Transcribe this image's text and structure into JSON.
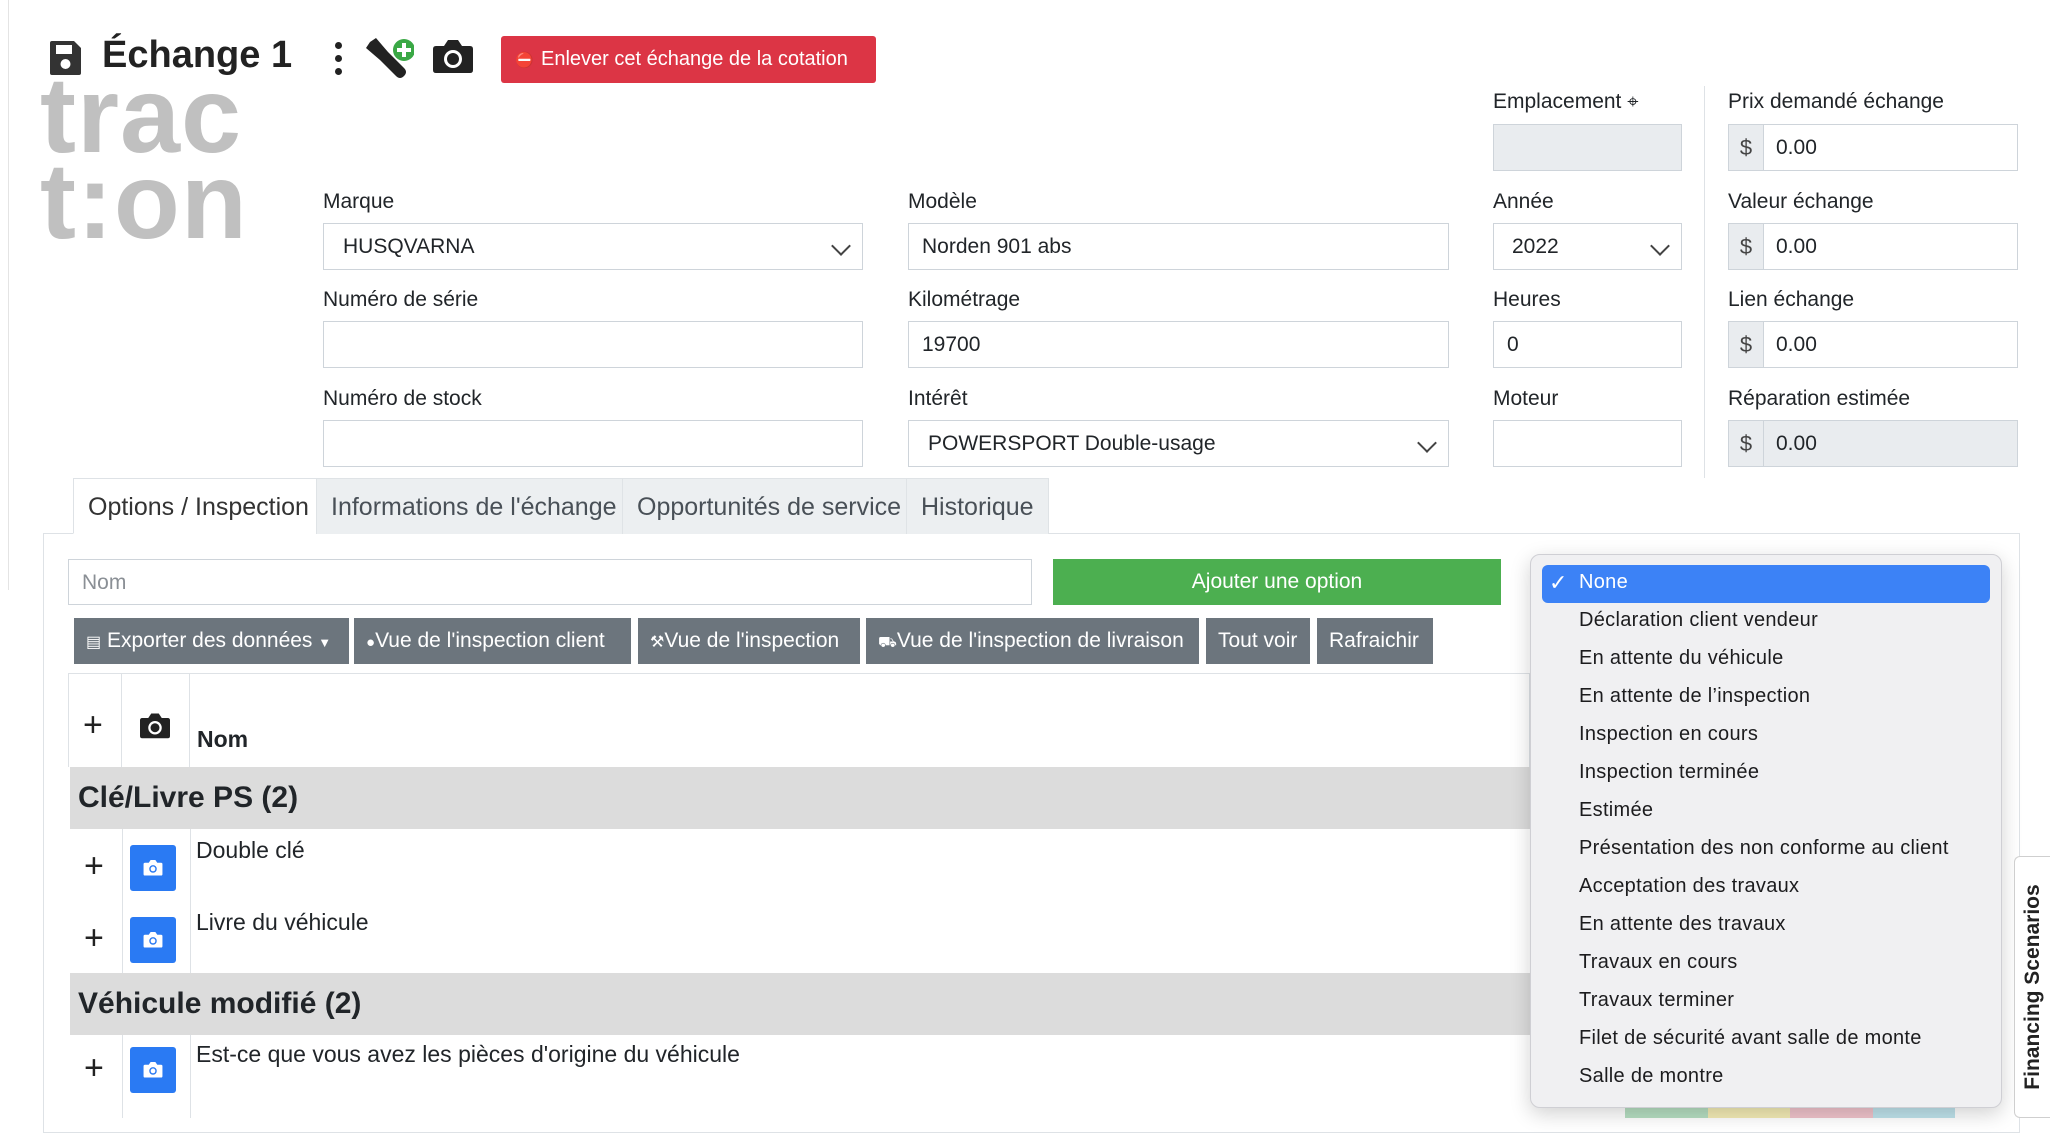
{
  "header": {
    "title": "Échange 1",
    "remove_button": "Enlever cet échange de la cotation",
    "logo_line1": "trac",
    "logo_line2": "t:on"
  },
  "form": {
    "emplacement_label": "Emplacement",
    "emplacement_value": "",
    "prix_demande_label": "Prix demandé échange",
    "prix_demande_value": "0.00",
    "marque_label": "Marque",
    "marque_value": "HUSQVARNA",
    "modele_label": "Modèle",
    "modele_value": "Norden 901 abs",
    "annee_label": "Année",
    "annee_value": "2022",
    "valeur_label": "Valeur échange",
    "valeur_value": "0.00",
    "serie_label": "Numéro de série",
    "serie_value": "",
    "km_label": "Kilométrage",
    "km_value": "19700",
    "heures_label": "Heures",
    "heures_value": "0",
    "lien_label": "Lien échange",
    "lien_value": "0.00",
    "stock_label": "Numéro de stock",
    "stock_value": "",
    "interet_label": "Intérêt",
    "interet_value": "POWERSPORT Double-usage",
    "moteur_label": "Moteur",
    "moteur_value": "",
    "reparation_label": "Réparation estimée",
    "reparation_value": "0.00",
    "currency": "$"
  },
  "tabs": [
    {
      "label": "Options / Inspection",
      "active": true
    },
    {
      "label": "Informations de l'échange"
    },
    {
      "label": "Opportunités de service"
    },
    {
      "label": "Historique"
    }
  ],
  "options": {
    "name_placeholder": "Nom",
    "add_button": "Ajouter une option",
    "toolbar": {
      "export": "Exporter des données",
      "client_view": "Vue de l'inspection client",
      "inspection_view": "Vue de l'inspection",
      "delivery_view": "Vue de l'inspection de livraison",
      "show_all": "Tout voir",
      "refresh": "Rafraichir"
    },
    "table_header_name": "Nom",
    "groups": [
      {
        "title": "Clé/Livre PS (2)",
        "rows": [
          "Double clé",
          "Livre du véhicule"
        ]
      },
      {
        "title": "Véhicule modifié (2)",
        "rows": [
          "Est-ce que vous avez les pièces d'origine du véhicule"
        ]
      }
    ]
  },
  "dropdown": {
    "selected": "None",
    "items": [
      "None",
      "Déclaration client vendeur",
      "En attente du véhicule",
      "En attente de l’inspection",
      "Inspection en cours",
      "Inspection terminée",
      "Estimée",
      "Présentation des non conforme au client",
      "Acceptation des travaux",
      "En attente des travaux",
      "Travaux en cours",
      "Travaux terminer",
      "Filet de sécurité avant salle de monte",
      "Salle de montre"
    ]
  },
  "side_tab": "Financing Scenarios",
  "colors": {
    "danger": "#dc3545",
    "success": "#4caf50",
    "dark_button": "#6c757d",
    "primary": "#2a7af3",
    "select_blue": "#3c82f6"
  }
}
